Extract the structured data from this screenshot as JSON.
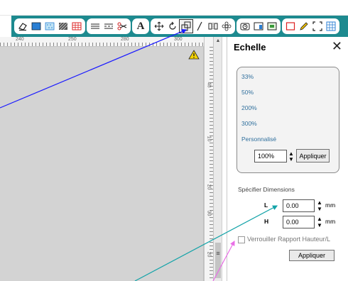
{
  "colors": {
    "toolbar_bg": "#1d8a8f",
    "canvas_bg": "#d3d3d3",
    "link_blue": "#2f6f9d",
    "annotation_blue": "#1a1aff",
    "annotation_teal": "#13a3a8",
    "annotation_pink": "#e96ee6",
    "warning_yellow": "#f5d300"
  },
  "toolbar": {
    "groups": [
      [
        "eraser-icon",
        "fill-blue-icon",
        "pattern-icon",
        "hatch-icon",
        "grid-red-icon"
      ],
      [
        "line-style-icon",
        "dash-style-icon",
        "scissors-icon"
      ],
      [
        "text-icon"
      ],
      [
        "move-icon",
        "rotate-icon",
        "scale-icon",
        "slant-icon",
        "mirror-icon",
        "flower-icon"
      ],
      [
        "clock-icon",
        "frame-icon",
        "image-icon"
      ],
      [
        "rect-red-icon",
        "pen-icon",
        "fullscreen-icon",
        "grid-icon"
      ]
    ],
    "text_glyph": "A"
  },
  "rulers": {
    "horizontal": [
      "240",
      "250",
      "280",
      "300"
    ],
    "vertical": [
      "40",
      "10",
      "20",
      "30",
      "20"
    ]
  },
  "panel": {
    "title": "Echelle",
    "close": "✕",
    "presets": [
      "33%",
      "50%",
      "200%",
      "300%",
      "Personnalisé"
    ],
    "scale_value": "100%",
    "apply_label": "Appliquer",
    "dimensions_title": "Spécifier Dimensions",
    "width_label": "L",
    "width_value": "0.00",
    "height_label": "H",
    "height_value": "0.00",
    "unit": "mm",
    "lock_ratio_label": "Verrouiller Rapport Hauteur/L",
    "dimensions_apply_label": "Appliquer"
  }
}
